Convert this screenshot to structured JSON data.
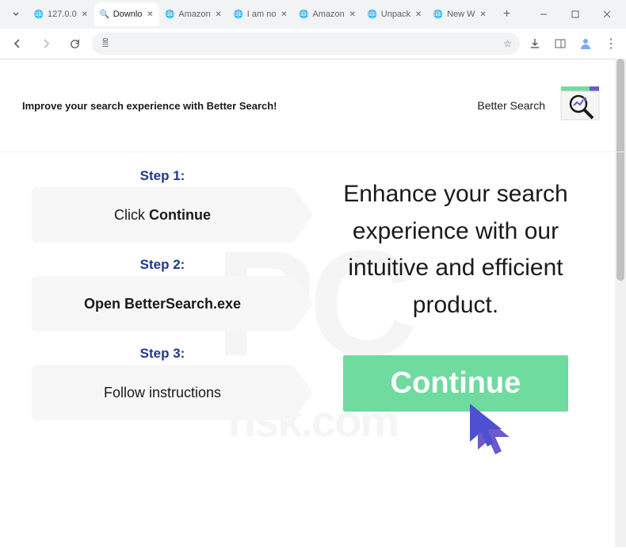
{
  "browser": {
    "tabs": [
      {
        "title": "127.0.0",
        "active": false
      },
      {
        "title": "Downlo",
        "active": true
      },
      {
        "title": "Amazon",
        "active": false
      },
      {
        "title": "I am no",
        "active": false
      },
      {
        "title": "Amazon",
        "active": false
      },
      {
        "title": "Unpack",
        "active": false
      },
      {
        "title": "New W",
        "active": false
      }
    ]
  },
  "header": {
    "tagline": "Improve your search experience with Better Search!",
    "brand": "Better Search"
  },
  "steps": [
    {
      "label": "Step 1:",
      "prefix": "Click ",
      "bold": "Continue"
    },
    {
      "label": "Step 2:",
      "prefix": "",
      "bold": "Open BetterSearch.exe"
    },
    {
      "label": "Step 3:",
      "prefix": "Follow instructions",
      "bold": ""
    }
  ],
  "headline": "Enhance your search experience with our intuitive and efficient product.",
  "cta": "Continue",
  "watermark": {
    "main": "PC",
    "sub": "risk.com"
  },
  "colors": {
    "accent_green": "#6fdb9f",
    "accent_purple": "#6a5acd",
    "step_label": "#1e3a8a"
  }
}
